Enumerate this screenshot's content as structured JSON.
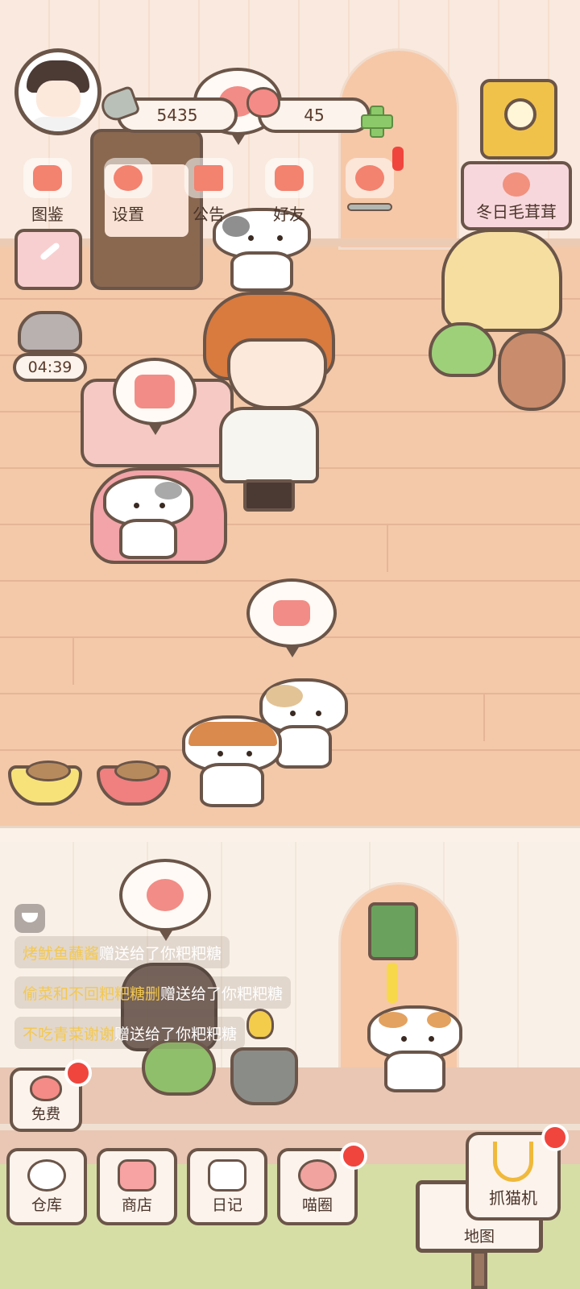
{
  "player": {
    "fish_count": "5435",
    "heart_count": "45"
  },
  "top_menu": [
    {
      "label": "图鉴",
      "icon": "cat-head-icon"
    },
    {
      "label": "设置",
      "icon": "gear-icon"
    },
    {
      "label": "公告",
      "icon": "gift-icon"
    },
    {
      "label": "好友",
      "icon": "friends-icon"
    }
  ],
  "event_sign": {
    "label": "冬日毛茸茸",
    "icon": "paw-icon"
  },
  "timer": {
    "value": "04:39"
  },
  "chat_feed": [
    {
      "sender": "烤鱿鱼蘸酱",
      "message": "赠送给了你粑粑糖"
    },
    {
      "sender": "偷菜和不回粑粑糖删",
      "message": "赠送给了你粑粑糖"
    },
    {
      "sender": "不吃青菜谢谢",
      "message": "赠送给了你粑粑糖"
    }
  ],
  "free_button": {
    "label": "免费",
    "icon": "heart-icon"
  },
  "bottom_nav": [
    {
      "label": "仓库",
      "icon": "warehouse-icon",
      "badge": false
    },
    {
      "label": "商店",
      "icon": "shop-icon",
      "badge": false
    },
    {
      "label": "日记",
      "icon": "diary-icon",
      "badge": false
    },
    {
      "label": "喵圈",
      "icon": "planet-cat-icon",
      "badge": true
    }
  ],
  "claw_machine": {
    "label": "抓猫机",
    "icon": "claw-icon"
  },
  "map_sign": {
    "label": "地图"
  },
  "colors": {
    "accent_red": "#f0453d",
    "outline": "#6b5549",
    "floor": "#f3c9a9",
    "chat_sender": "#f3c84f"
  }
}
